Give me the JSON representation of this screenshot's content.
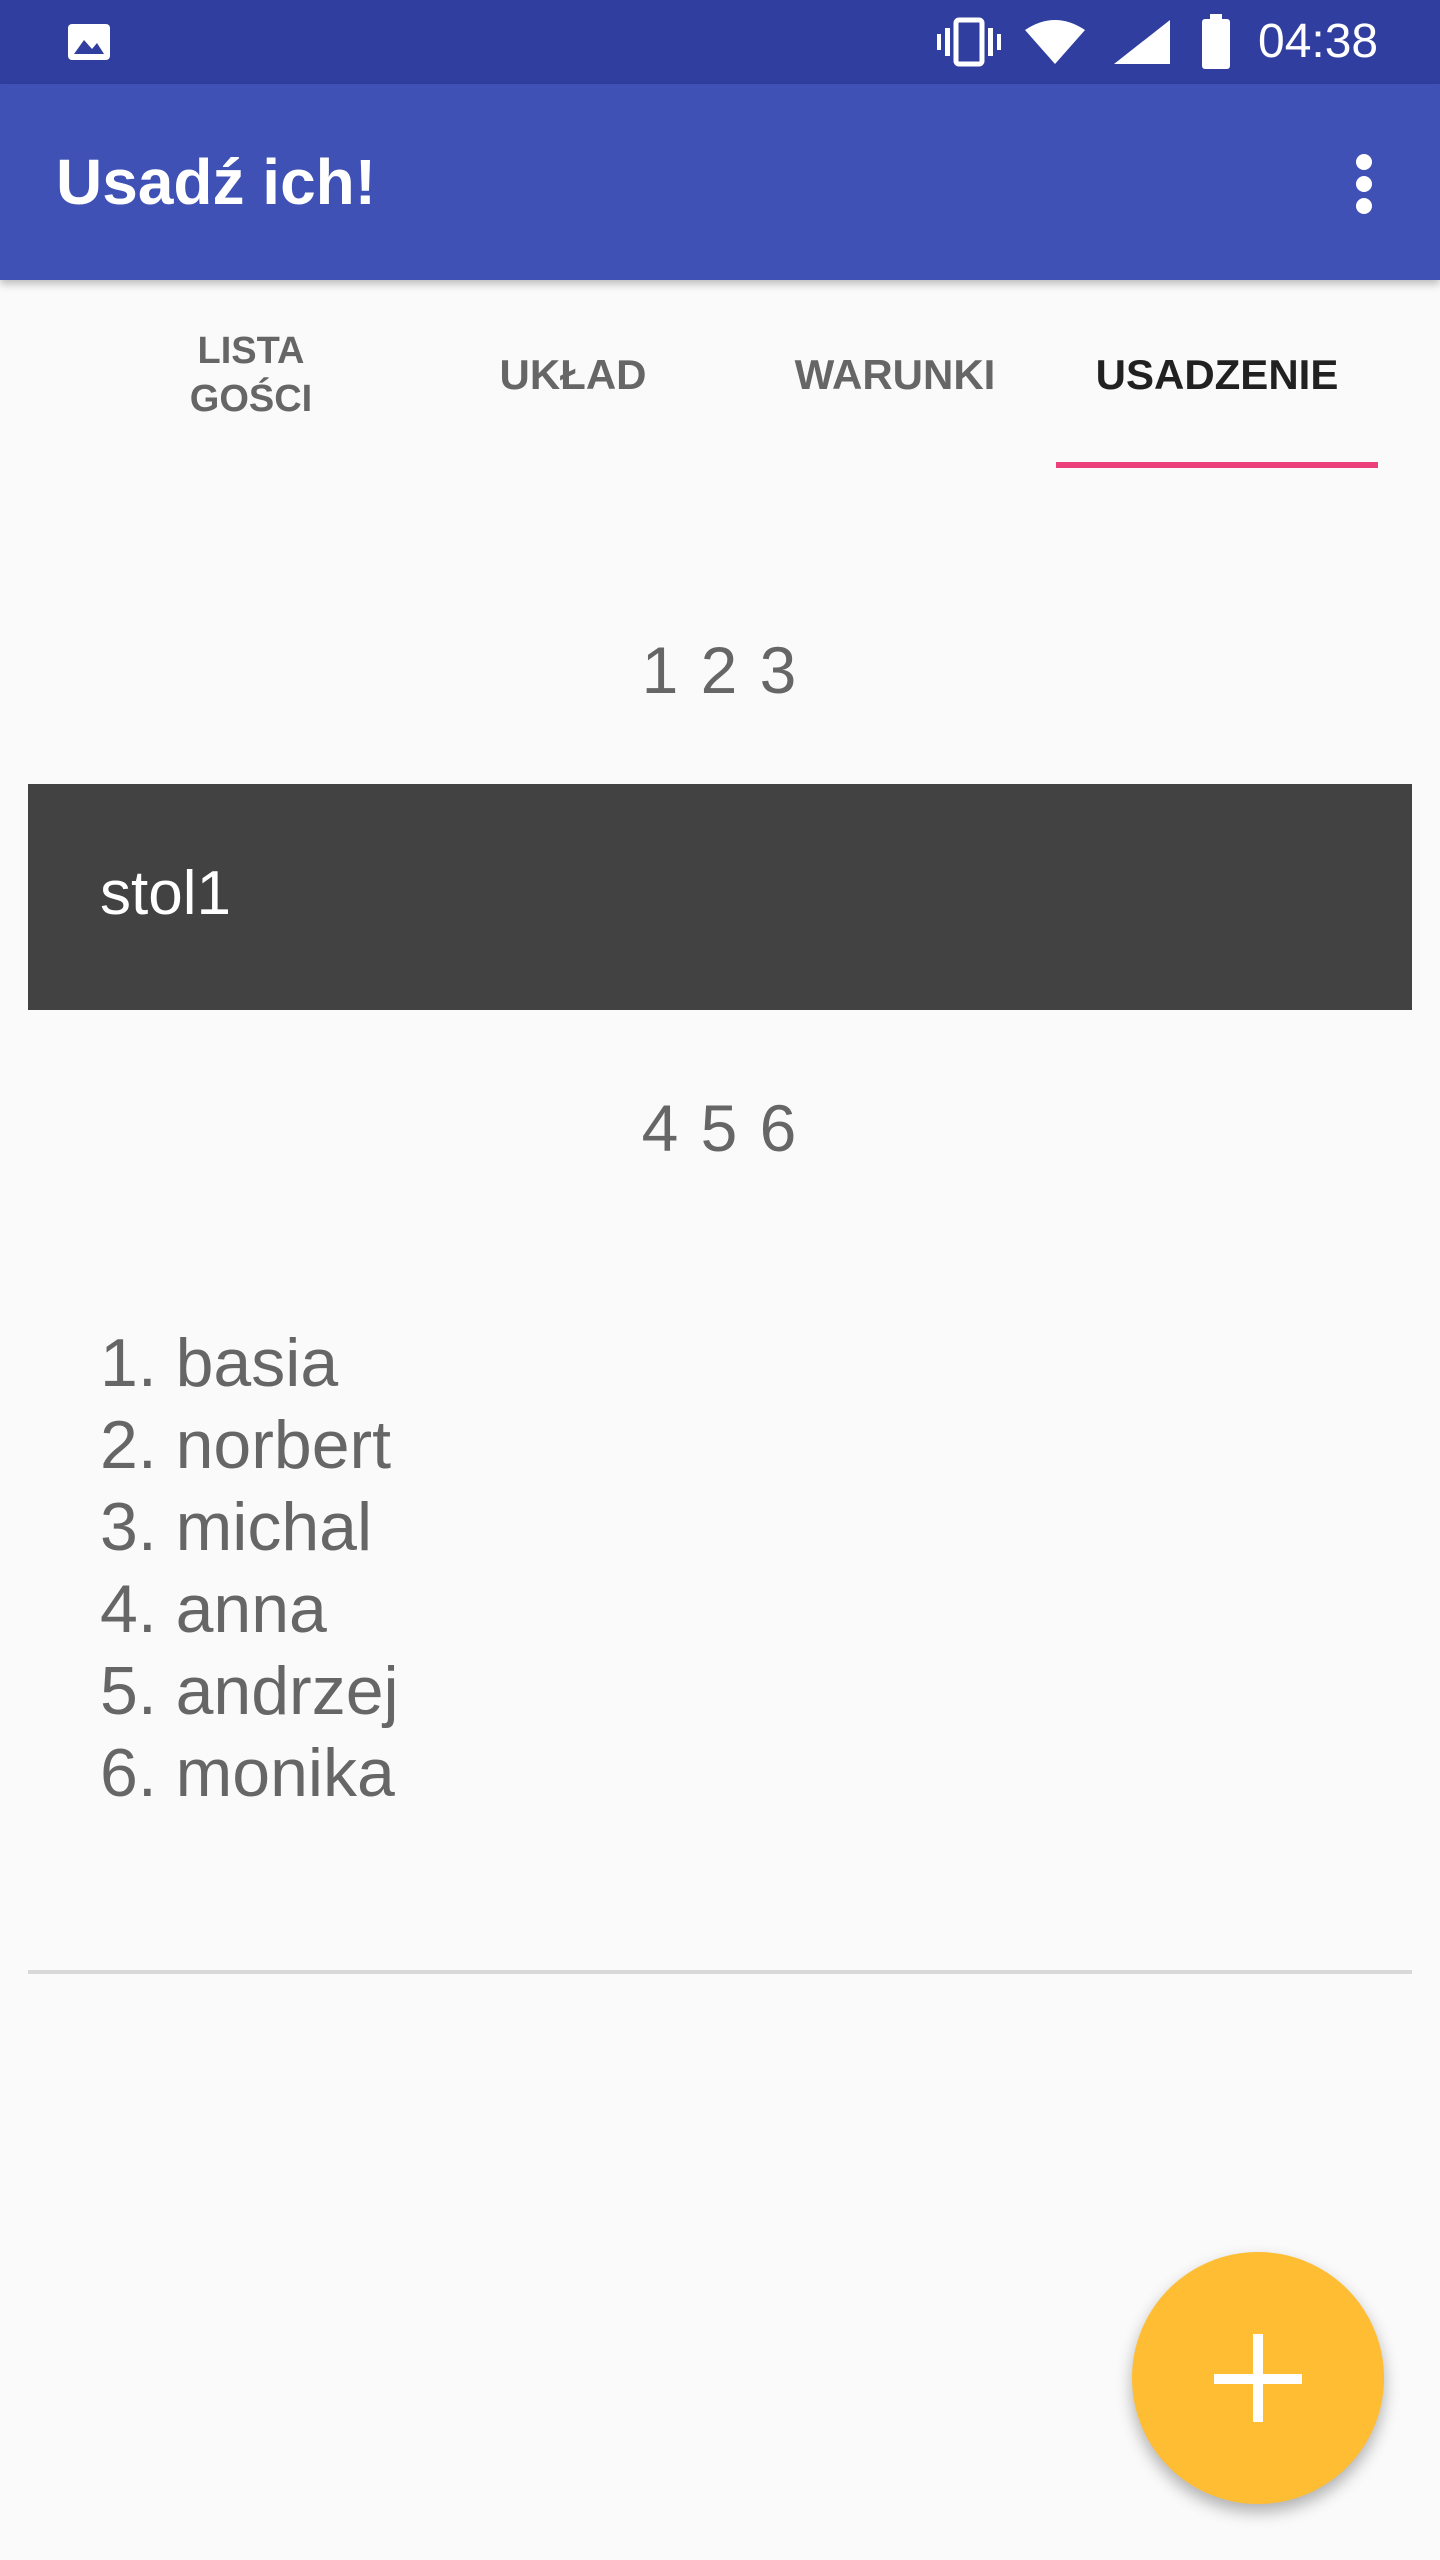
{
  "status_bar": {
    "time": "04:38",
    "left_icon": "gallery-icon",
    "right_icons": [
      "vibrate-icon",
      "wifi-icon",
      "signal-icon",
      "battery-icon"
    ]
  },
  "app_bar": {
    "title": "Usadź ich!",
    "menu_icon": "more-vert-icon"
  },
  "tabs": [
    {
      "label": "LISTA\nGOŚCI",
      "active": false
    },
    {
      "label": "UKŁAD",
      "active": false
    },
    {
      "label": "WARUNKI",
      "active": false
    },
    {
      "label": "USADZENIE",
      "active": true
    }
  ],
  "seating": {
    "top_seats": "1 2 3",
    "table_name": "stol1",
    "bottom_seats": "4 5 6",
    "guests": [
      "1. basia",
      "2. norbert",
      "3. michal",
      "4. anna",
      "5. andrzej",
      "6. monika"
    ]
  },
  "fab": {
    "icon": "plus-icon"
  },
  "colors": {
    "status_bar": "#303f9f",
    "app_bar": "#3f51b5",
    "tab_indicator": "#ec407a",
    "table_card": "#424242",
    "fab": "#ffbd33",
    "background": "#fafafa"
  }
}
